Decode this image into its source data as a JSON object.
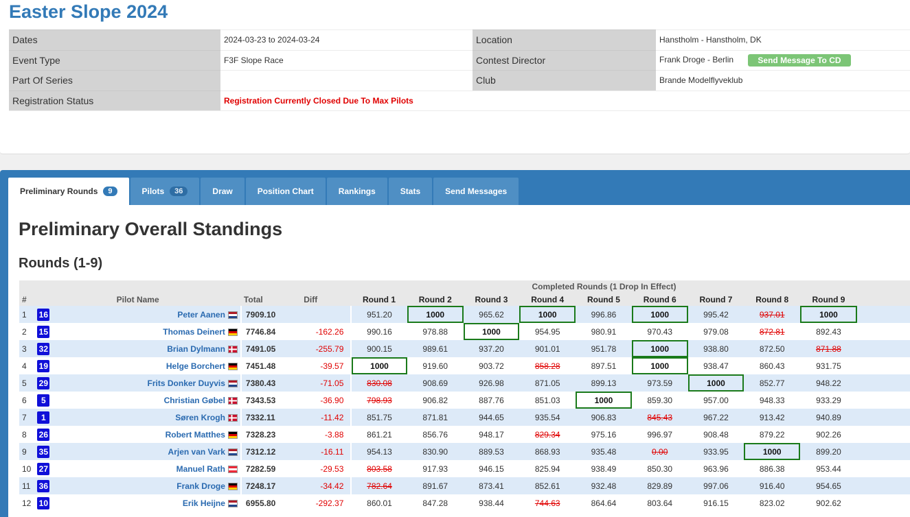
{
  "event": {
    "title": "Easter Slope 2024",
    "dates_label": "Dates",
    "dates_value": "2024-03-23 to 2024-03-24",
    "event_type_label": "Event Type",
    "event_type_value": "F3F Slope Race",
    "series_label": "Part Of Series",
    "series_value": "",
    "registration_label": "Registration Status",
    "registration_value": "Registration Currently Closed Due To Max Pilots",
    "location_label": "Location",
    "location_value": "Hanstholm - Hanstholm, DK",
    "cd_label": "Contest Director",
    "cd_value": "Frank Droge - Berlin",
    "cd_button": "Send Message To CD",
    "club_label": "Club",
    "club_value": "Brande Modelflyveklub"
  },
  "tabs": [
    {
      "label": "Preliminary Rounds",
      "badge": "9"
    },
    {
      "label": "Pilots",
      "badge": "36"
    },
    {
      "label": "Draw"
    },
    {
      "label": "Position Chart"
    },
    {
      "label": "Rankings"
    },
    {
      "label": "Stats"
    },
    {
      "label": "Send Messages"
    }
  ],
  "standings": {
    "title": "Preliminary Overall Standings",
    "subtitle": "Rounds (1-9)",
    "group_header": "Completed Rounds (1 Drop In Effect)",
    "headers": {
      "num": "#",
      "pilot": "Pilot Name",
      "total": "Total",
      "diff": "Diff",
      "rounds": [
        "Round 1",
        "Round 2",
        "Round 3",
        "Round 4",
        "Round 5",
        "Round 6",
        "Round 7",
        "Round 8",
        "Round 9"
      ]
    },
    "rows": [
      {
        "pos": "1",
        "bib": "16",
        "name": "Peter Aanen",
        "flag": "nl",
        "total": "7909.10",
        "diff": "",
        "scores": [
          "951.20",
          "1000",
          "965.62",
          "1000",
          "996.86",
          "1000",
          "995.42",
          "937.01",
          "1000"
        ],
        "best": [
          1,
          3,
          5,
          8
        ],
        "drop": [
          7
        ]
      },
      {
        "pos": "2",
        "bib": "15",
        "name": "Thomas Deinert",
        "flag": "de",
        "total": "7746.84",
        "diff": "-162.26",
        "scores": [
          "990.16",
          "978.88",
          "1000",
          "954.95",
          "980.91",
          "970.43",
          "979.08",
          "872.81",
          "892.43"
        ],
        "best": [
          2
        ],
        "drop": [
          7
        ]
      },
      {
        "pos": "3",
        "bib": "32",
        "name": "Brian Dylmann",
        "flag": "dk",
        "total": "7491.05",
        "diff": "-255.79",
        "scores": [
          "900.15",
          "989.61",
          "937.20",
          "901.01",
          "951.78",
          "1000",
          "938.80",
          "872.50",
          "871.88"
        ],
        "best": [
          5
        ],
        "drop": [
          8
        ]
      },
      {
        "pos": "4",
        "bib": "19",
        "name": "Helge Borchert",
        "flag": "de",
        "total": "7451.48",
        "diff": "-39.57",
        "scores": [
          "1000",
          "919.60",
          "903.72",
          "858.28",
          "897.51",
          "1000",
          "938.47",
          "860.43",
          "931.75"
        ],
        "best": [
          0,
          5
        ],
        "drop": [
          3
        ]
      },
      {
        "pos": "5",
        "bib": "29",
        "name": "Frits Donker Duyvis",
        "flag": "nl",
        "total": "7380.43",
        "diff": "-71.05",
        "scores": [
          "830.08",
          "908.69",
          "926.98",
          "871.05",
          "899.13",
          "973.59",
          "1000",
          "852.77",
          "948.22"
        ],
        "best": [
          6
        ],
        "drop": [
          0
        ]
      },
      {
        "pos": "6",
        "bib": "5",
        "name": "Christian Gøbel",
        "flag": "dk",
        "total": "7343.53",
        "diff": "-36.90",
        "scores": [
          "798.93",
          "906.82",
          "887.76",
          "851.03",
          "1000",
          "859.30",
          "957.00",
          "948.33",
          "933.29"
        ],
        "best": [
          4
        ],
        "drop": [
          0
        ]
      },
      {
        "pos": "7",
        "bib": "1",
        "name": "Søren Krogh",
        "flag": "dk",
        "total": "7332.11",
        "diff": "-11.42",
        "scores": [
          "851.75",
          "871.81",
          "944.65",
          "935.54",
          "906.83",
          "845.43",
          "967.22",
          "913.42",
          "940.89"
        ],
        "best": [],
        "drop": [
          5
        ]
      },
      {
        "pos": "8",
        "bib": "26",
        "name": "Robert Matthes",
        "flag": "de",
        "total": "7328.23",
        "diff": "-3.88",
        "scores": [
          "861.21",
          "856.76",
          "948.17",
          "829.34",
          "975.16",
          "996.97",
          "908.48",
          "879.22",
          "902.26"
        ],
        "best": [],
        "drop": [
          3
        ]
      },
      {
        "pos": "9",
        "bib": "35",
        "name": "Arjen van Vark",
        "flag": "nl",
        "total": "7312.12",
        "diff": "-16.11",
        "scores": [
          "954.13",
          "830.90",
          "889.53",
          "868.93",
          "935.48",
          "0.00",
          "933.95",
          "1000",
          "899.20"
        ],
        "best": [
          7
        ],
        "drop": [
          5
        ]
      },
      {
        "pos": "10",
        "bib": "27",
        "name": "Manuel Rath",
        "flag": "at",
        "total": "7282.59",
        "diff": "-29.53",
        "scores": [
          "803.58",
          "917.93",
          "946.15",
          "825.94",
          "938.49",
          "850.30",
          "963.96",
          "886.38",
          "953.44"
        ],
        "best": [],
        "drop": [
          0
        ]
      },
      {
        "pos": "11",
        "bib": "36",
        "name": "Frank Droge",
        "flag": "de",
        "total": "7248.17",
        "diff": "-34.42",
        "scores": [
          "782.64",
          "891.67",
          "873.41",
          "852.61",
          "932.48",
          "829.89",
          "997.06",
          "916.40",
          "954.65"
        ],
        "best": [],
        "drop": [
          0
        ]
      },
      {
        "pos": "12",
        "bib": "10",
        "name": "Erik Heijne",
        "flag": "nl",
        "total": "6955.80",
        "diff": "-292.37",
        "scores": [
          "860.01",
          "847.28",
          "938.44",
          "744.63",
          "864.64",
          "803.64",
          "916.15",
          "823.02",
          "902.62"
        ],
        "best": [],
        "drop": [
          3
        ]
      }
    ]
  }
}
